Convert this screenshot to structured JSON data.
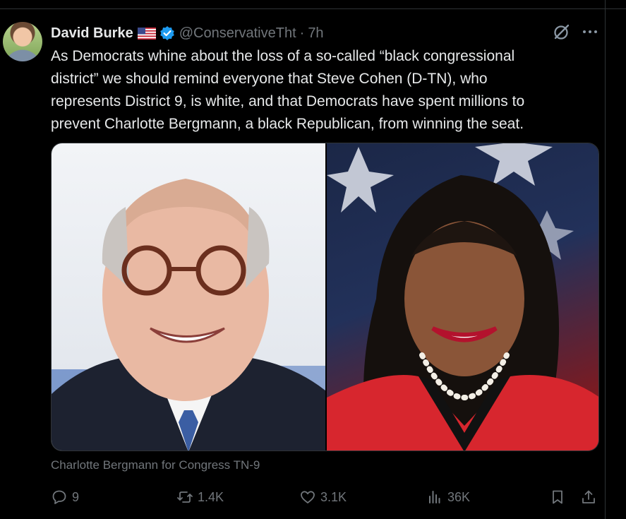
{
  "tweet": {
    "author": {
      "display_name": "David Burke",
      "handle": "@ConservativeTht",
      "time": "7h",
      "separator": "·",
      "flag": "us-flag-icon",
      "verified": "verified-badge-icon"
    },
    "text": "As Democrats whine about the loss of a so-called “black congressional\ndistrict” we should remind everyone that Steve Cohen (D-TN), who\nrepresents District 9, is white, and that Democrats have spent millions to\nprevent Charlotte Bergmann, a black Republican, from winning the seat.",
    "media": {
      "images": [
        "photo of man with glasses",
        "photo of woman with pearl necklace"
      ],
      "caption": "Charlotte Bergmann for Congress TN-9"
    },
    "actions": {
      "replies": "9",
      "reposts": "1.4K",
      "likes": "3.1K",
      "views": "36K"
    }
  },
  "colors": {
    "background": "#000000",
    "text_primary": "#e7e9ea",
    "text_secondary": "#71767b",
    "verified_blue": "#1d9bf0",
    "border": "#2f3336"
  }
}
